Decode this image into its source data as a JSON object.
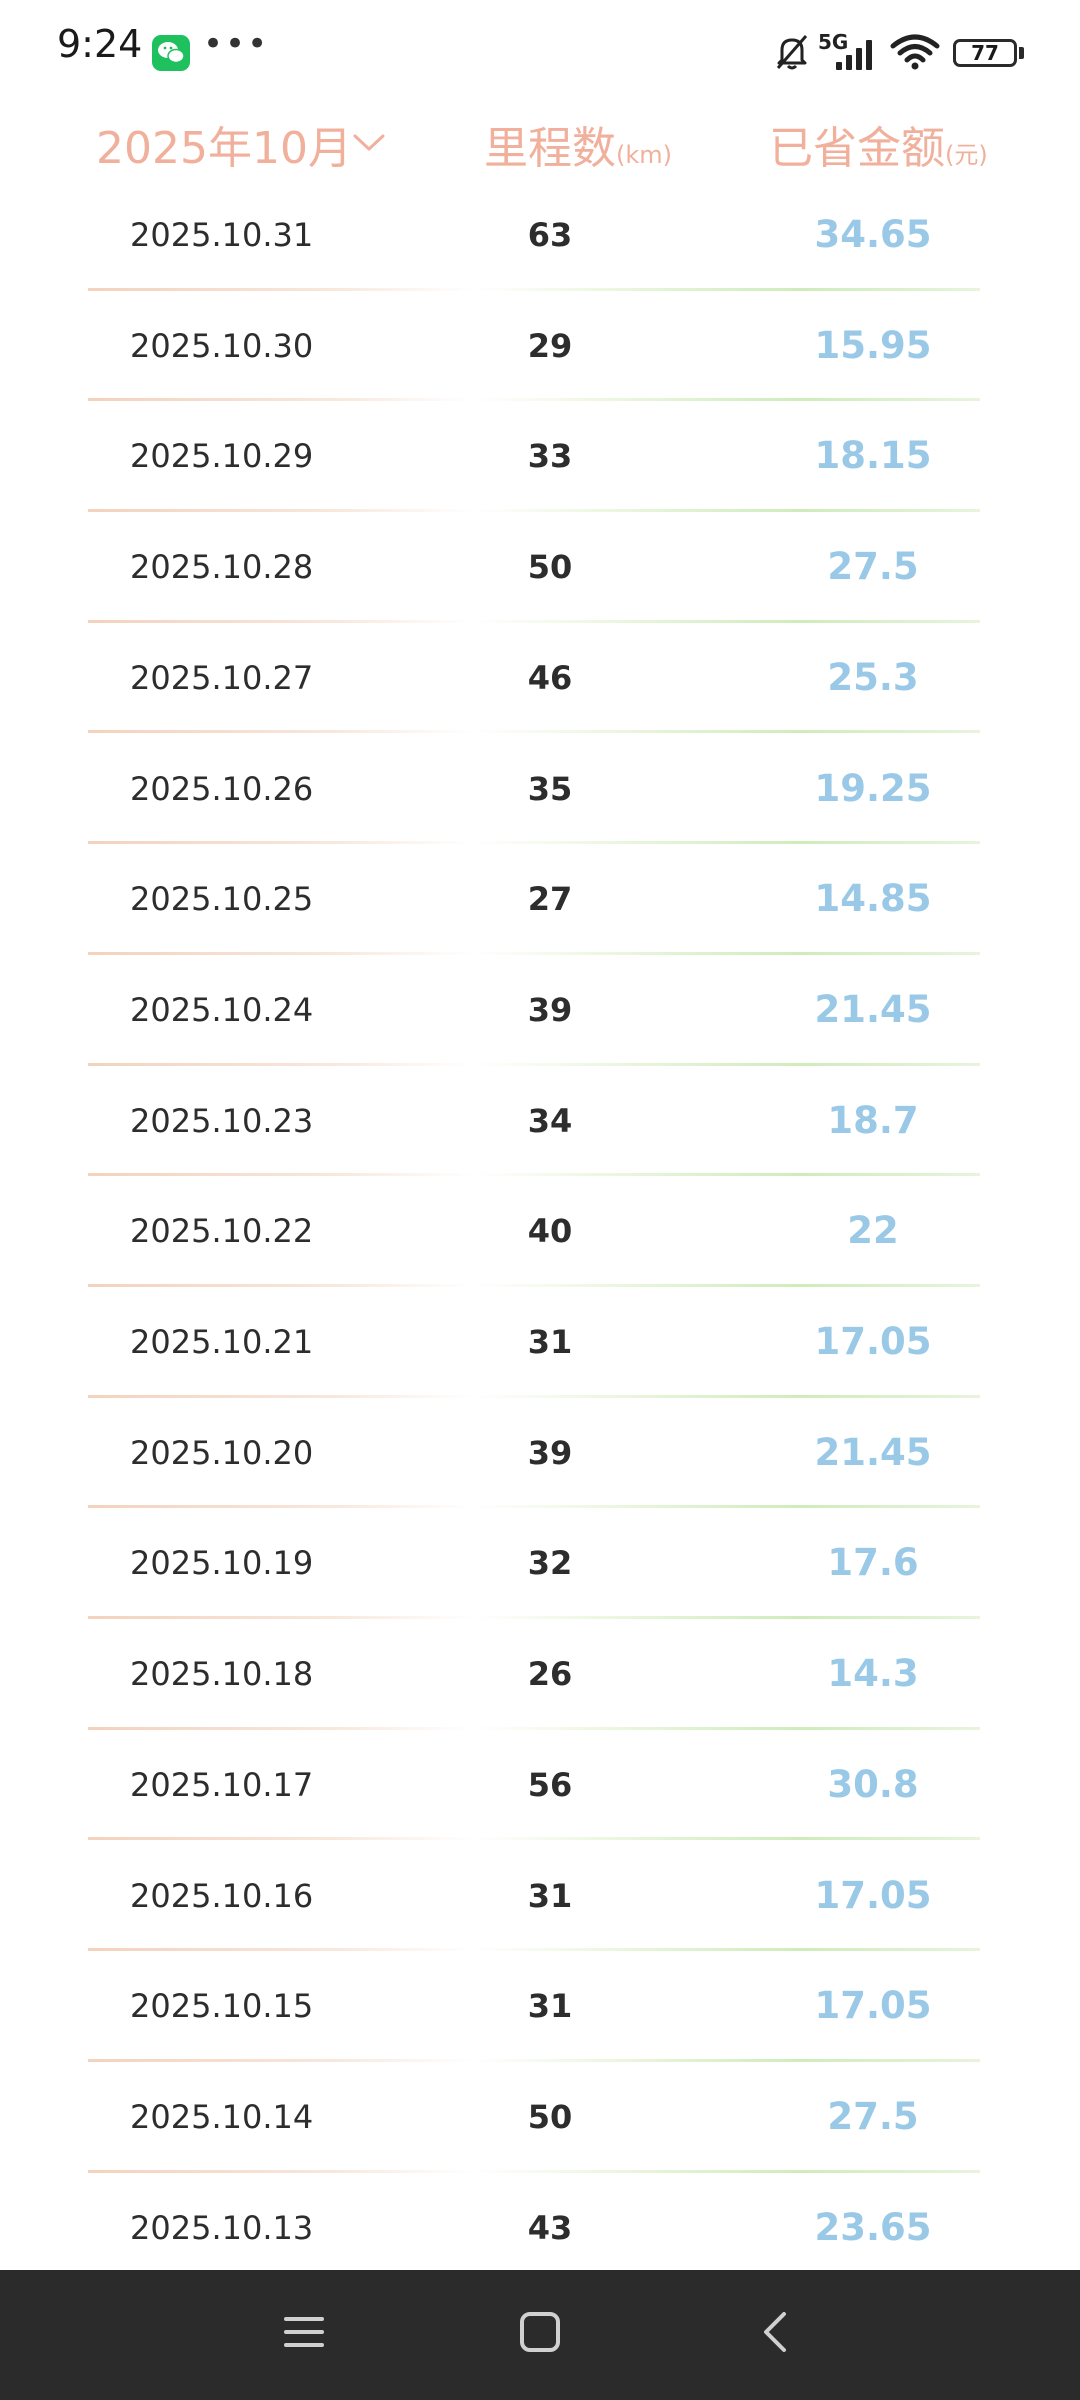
{
  "status_bar": {
    "time": "9:24",
    "network": "5G",
    "battery": "77",
    "battery_percent": 77,
    "icons": [
      "wechat-icon",
      "more-dots-icon",
      "mute-icon",
      "signal-icon",
      "wifi-icon",
      "battery-icon"
    ]
  },
  "header": {
    "month": "2025年10月",
    "mileage_title": "里程数",
    "mileage_unit": "(km)",
    "saved_title": "已省金额",
    "saved_unit": "(元)"
  },
  "colors": {
    "header_text": "#f0b09c",
    "saved_value": "#99c9e6",
    "nav_bar": "#2b2b2b"
  },
  "rows": [
    {
      "date": "2025.10.31",
      "km": "63",
      "saved": "34.65"
    },
    {
      "date": "2025.10.30",
      "km": "29",
      "saved": "15.95"
    },
    {
      "date": "2025.10.29",
      "km": "33",
      "saved": "18.15"
    },
    {
      "date": "2025.10.28",
      "km": "50",
      "saved": "27.5"
    },
    {
      "date": "2025.10.27",
      "km": "46",
      "saved": "25.3"
    },
    {
      "date": "2025.10.26",
      "km": "35",
      "saved": "19.25"
    },
    {
      "date": "2025.10.25",
      "km": "27",
      "saved": "14.85"
    },
    {
      "date": "2025.10.24",
      "km": "39",
      "saved": "21.45"
    },
    {
      "date": "2025.10.23",
      "km": "34",
      "saved": "18.7"
    },
    {
      "date": "2025.10.22",
      "km": "40",
      "saved": "22"
    },
    {
      "date": "2025.10.21",
      "km": "31",
      "saved": "17.05"
    },
    {
      "date": "2025.10.20",
      "km": "39",
      "saved": "21.45"
    },
    {
      "date": "2025.10.19",
      "km": "32",
      "saved": "17.6"
    },
    {
      "date": "2025.10.18",
      "km": "26",
      "saved": "14.3"
    },
    {
      "date": "2025.10.17",
      "km": "56",
      "saved": "30.8"
    },
    {
      "date": "2025.10.16",
      "km": "31",
      "saved": "17.05"
    },
    {
      "date": "2025.10.15",
      "km": "31",
      "saved": "17.05"
    },
    {
      "date": "2025.10.14",
      "km": "50",
      "saved": "27.5"
    },
    {
      "date": "2025.10.13",
      "km": "43",
      "saved": "23.65"
    }
  ],
  "nav_bar": {
    "icons": [
      "menu-icon",
      "home-icon",
      "back-icon"
    ]
  }
}
